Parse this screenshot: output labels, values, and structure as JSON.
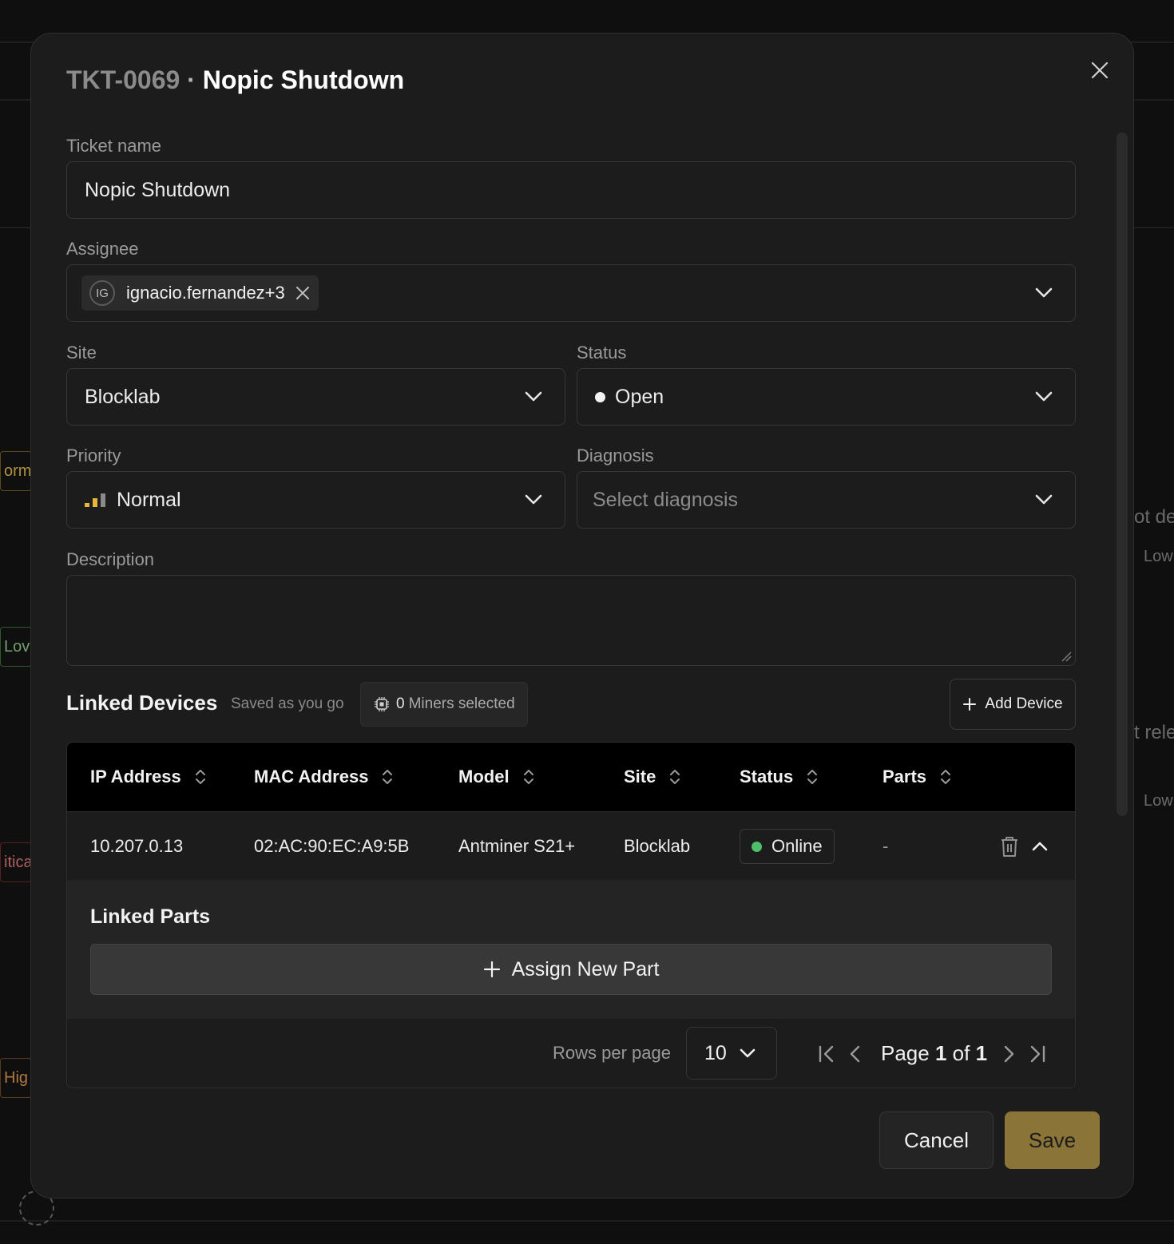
{
  "background": {
    "fragments": [
      "orma",
      "Lov",
      "itica",
      "Hig",
      "ot de",
      "Low",
      "t rele",
      "Low"
    ]
  },
  "modal": {
    "title_id": "TKT-0069",
    "title_sep": " · ",
    "title_name": "Nopic Shutdown",
    "close_icon": "close-icon"
  },
  "form": {
    "ticket_name": {
      "label": "Ticket name",
      "value": "Nopic Shutdown"
    },
    "assignee": {
      "label": "Assignee",
      "chip_initials": "IG",
      "chip_text": "ignacio.fernandez+3"
    },
    "site": {
      "label": "Site",
      "value": "Blocklab"
    },
    "status": {
      "label": "Status",
      "value": "Open"
    },
    "priority": {
      "label": "Priority",
      "value": "Normal",
      "icon": "signal-bars-icon",
      "color": "#e8b53a"
    },
    "diagnosis": {
      "label": "Diagnosis",
      "placeholder": "Select diagnosis"
    },
    "description": {
      "label": "Description",
      "value": ""
    }
  },
  "linked_devices": {
    "title": "Linked Devices",
    "saved_note": "Saved as you go",
    "miners_count": "0",
    "miners_label": "Miners selected",
    "add_device_label": "Add Device",
    "columns": [
      "IP Address",
      "MAC Address",
      "Model",
      "Site",
      "Status",
      "Parts"
    ],
    "rows": [
      {
        "ip": "10.207.0.13",
        "mac": "02:AC:90:EC:A9:5B",
        "model": "Antminer S21+",
        "site": "Blocklab",
        "status": "Online",
        "parts": "-"
      }
    ],
    "linked_parts_title": "Linked Parts",
    "assign_part_label": "Assign New Part",
    "pagination": {
      "rows_per_page_label": "Rows per page",
      "rows_per_page": "10",
      "page_word": "Page",
      "page_current": "1",
      "of_word": "of",
      "page_total": "1"
    }
  },
  "actions": {
    "cancel": "Cancel",
    "save": "Save"
  },
  "colors": {
    "online": "#4fbf6b",
    "save_bg": "#8a7438",
    "priority": "#e8b53a"
  }
}
